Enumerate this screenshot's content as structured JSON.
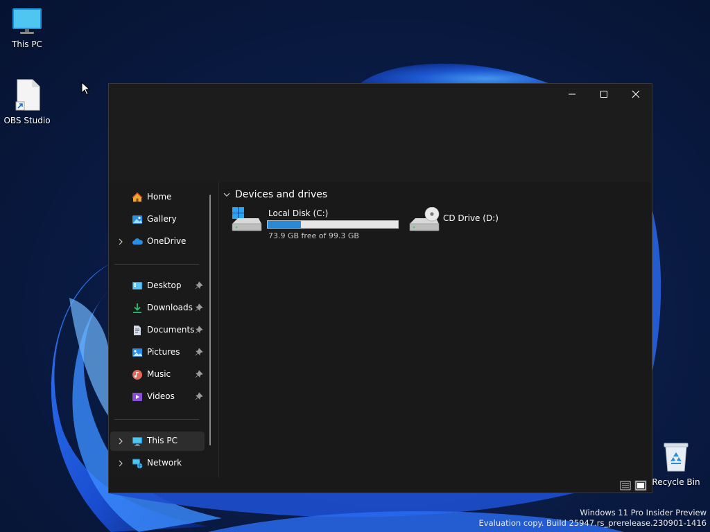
{
  "desktop": {
    "icons": [
      {
        "label": "This PC",
        "icon": "monitor-icon"
      },
      {
        "label": "OBS Studio",
        "icon": "shortcut-file-icon"
      },
      {
        "label": "Recycle Bin",
        "icon": "recycle-bin-icon"
      }
    ],
    "watermark": {
      "line1": "Windows 11 Pro Insider Preview",
      "line2": "Evaluation copy. Build 25947.rs_prerelease.230901-1416"
    }
  },
  "window": {
    "controls": {
      "minimize": "minimize-icon",
      "maximize": "maximize-icon",
      "close": "close-icon"
    },
    "nav": {
      "items": [
        {
          "label": "Home",
          "icon": "home-icon",
          "chevron": false,
          "pinned": false
        },
        {
          "label": "Gallery",
          "icon": "gallery-icon",
          "chevron": false,
          "pinned": false
        },
        {
          "label": "OneDrive",
          "icon": "onedrive-cloud-icon",
          "chevron": true,
          "pinned": false
        },
        {
          "label": "Desktop",
          "icon": "desktop-folder-icon",
          "chevron": false,
          "pinned": true
        },
        {
          "label": "Downloads",
          "icon": "downloads-icon",
          "chevron": false,
          "pinned": true
        },
        {
          "label": "Documents",
          "icon": "documents-icon",
          "chevron": false,
          "pinned": true
        },
        {
          "label": "Pictures",
          "icon": "pictures-icon",
          "chevron": false,
          "pinned": true
        },
        {
          "label": "Music",
          "icon": "music-icon",
          "chevron": false,
          "pinned": true
        },
        {
          "label": "Videos",
          "icon": "videos-icon",
          "chevron": false,
          "pinned": true
        },
        {
          "label": "This PC",
          "icon": "this-pc-icon",
          "chevron": true,
          "pinned": false,
          "selected": true
        },
        {
          "label": "Network",
          "icon": "network-icon",
          "chevron": true,
          "pinned": false
        }
      ]
    },
    "content": {
      "group_title": "Devices and drives",
      "drives": [
        {
          "name": "Local Disk (C:)",
          "free_text": "73.9 GB free of 99.3 GB",
          "used_fraction": 0.256,
          "icon": "windows-drive-icon"
        },
        {
          "name": "CD Drive (D:)",
          "icon": "cd-drive-icon"
        }
      ]
    },
    "status": {
      "details_view_icon": "details-view-icon",
      "tiles_view_icon": "large-icons-view-icon"
    }
  },
  "colors": {
    "accent": "#2a8ad8",
    "window_bg": "#191919",
    "selected_bg": "#2d2d2d"
  }
}
